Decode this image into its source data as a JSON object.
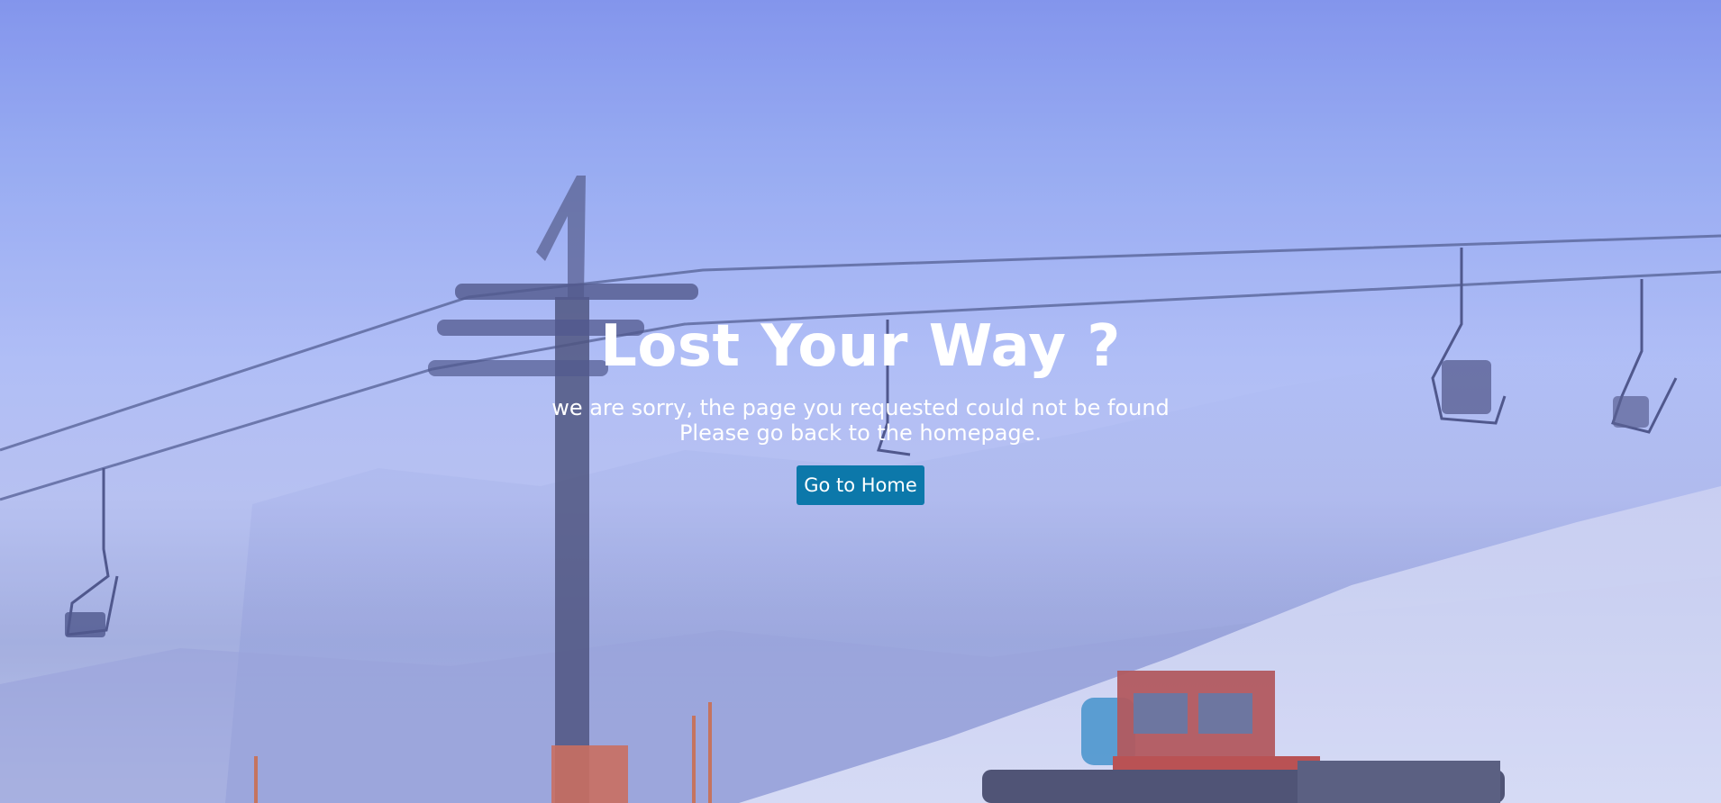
{
  "hero": {
    "title": "Lost Your Way ?",
    "subtitle_line1": "we are sorry, the page you requested could not be found",
    "subtitle_line2": "Please go back to the homepage.",
    "home_button_label": "Go to Home"
  },
  "colors": {
    "button_bg": "#0c78aa",
    "text": "#ffffff",
    "sky_top": "#8597ec"
  },
  "background": {
    "scene": "ski-lift-in-fog"
  }
}
